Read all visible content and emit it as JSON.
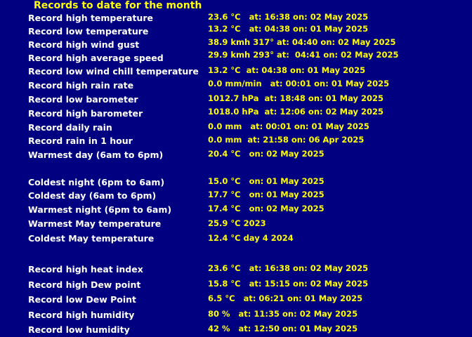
{
  "page": {
    "title": "Records to date for the month",
    "colors": {
      "background": "#000080",
      "label": "#ffffff",
      "value": "#ffff00",
      "title": "#ffff00"
    }
  },
  "records": [
    {
      "label": "Record high temperature",
      "value": "23.6 °C   at: 16:38 on: 02 May 2025"
    },
    {
      "label": "Record low temperature",
      "value": "13.2 °C   at: 04:38 on: 01 May 2025"
    },
    {
      "label": "Record high wind gust",
      "value": "38.9 kmh 317° at: 04:40 on: 02 May 2025"
    },
    {
      "label": "Record high average speed",
      "value": "29.9 kmh 293° at:  04:41 on: 02 May 2025"
    },
    {
      "label": "Record low wind chill temperature",
      "value": "13.2 °C  at: 04:38 on: 01 May 2025"
    },
    {
      "label": "Record high rain rate",
      "value": "0.0 mm/min   at: 00:01 on: 01 May 2025"
    },
    {
      "label": "Record low barometer",
      "value": "1012.7 hPa  at: 18:48 on: 01 May 2025"
    },
    {
      "label": "Record high barometer",
      "value": "1018.0 hPa  at: 12:06 on: 02 May 2025"
    },
    {
      "label": "Record daily rain",
      "value": "0.0 mm   at: 00:01 on: 01 May 2025"
    },
    {
      "label": "Record rain in 1 hour",
      "value": "0.0 mm  at: 21:58 on: 06 Apr 2025"
    },
    {
      "label": "Warmest day (6am to 6pm)",
      "value": "20.4 °C   on: 02 May 2025"
    },
    {
      "label": "Coldest night (6pm to 6am)",
      "value": "15.0 °C   on: 01 May 2025"
    },
    {
      "label": "Coldest day (6am to 6pm)",
      "value": "17.7 °C   on: 01 May 2025"
    },
    {
      "label": "Warmest night (6pm to 6am)",
      "value": "17.4 °C   on: 02 May 2025"
    },
    {
      "label": "Warmest May temperature",
      "value": "25.9 °C 2023"
    },
    {
      "label": "Coldest May temperature",
      "value": "12.4 °C day 4 2024"
    },
    {
      "label": "Record high heat index",
      "value": "23.6 °C   at: 16:38 on: 02 May 2025"
    },
    {
      "label": "Record high Dew point",
      "value": "15.8 °C   at: 15:15 on: 02 May 2025"
    },
    {
      "label": "Record low Dew Point",
      "value": "6.5 °C   at: 06:21 on: 01 May 2025"
    },
    {
      "label": "Record high humidity",
      "value": "80 %   at: 11:35 on: 02 May 2025"
    },
    {
      "label": "Record low humidity",
      "value": "42 %   at: 12:50 on: 01 May 2025"
    }
  ]
}
